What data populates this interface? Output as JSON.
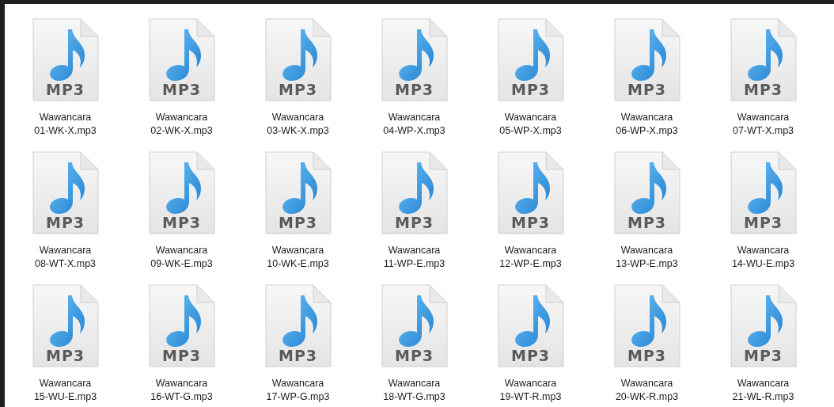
{
  "files": [
    {
      "name": "Wawancara\n01-WK-X.mp3",
      "type_label": "MP3",
      "selected": false
    },
    {
      "name": "Wawancara\n02-WK-X.mp3",
      "type_label": "MP3",
      "selected": false
    },
    {
      "name": "Wawancara\n03-WK-X.mp3",
      "type_label": "MP3",
      "selected": false
    },
    {
      "name": "Wawancara\n04-WP-X.mp3",
      "type_label": "MP3",
      "selected": false
    },
    {
      "name": "Wawancara\n05-WP-X.mp3",
      "type_label": "MP3",
      "selected": false
    },
    {
      "name": "Wawancara\n06-WP-X.mp3",
      "type_label": "MP3",
      "selected": false
    },
    {
      "name": "Wawancara\n07-WT-X.mp3",
      "type_label": "MP3",
      "selected": false
    },
    {
      "name": "Wawancara\n08-WT-X.mp3",
      "type_label": "MP3",
      "selected": false
    },
    {
      "name": "Wawancara\n09-WK-E.mp3",
      "type_label": "MP3",
      "selected": false
    },
    {
      "name": "Wawancara\n10-WK-E.mp3",
      "type_label": "MP3",
      "selected": false
    },
    {
      "name": "Wawancara\n11-WP-E.mp3",
      "type_label": "MP3",
      "selected": false
    },
    {
      "name": "Wawancara\n12-WP-E.mp3",
      "type_label": "MP3",
      "selected": false
    },
    {
      "name": "Wawancara\n13-WP-E.mp3",
      "type_label": "MP3",
      "selected": false
    },
    {
      "name": "Wawancara\n14-WU-E.mp3",
      "type_label": "MP3",
      "selected": false
    },
    {
      "name": "Wawancara\n15-WU-E.mp3",
      "type_label": "MP3",
      "selected": false
    },
    {
      "name": "Wawancara\n16-WT-G.mp3",
      "type_label": "MP3",
      "selected": false
    },
    {
      "name": "Wawancara\n17-WP-G.mp3",
      "type_label": "MP3",
      "selected": false
    },
    {
      "name": "Wawancara\n18-WT-G.mp3",
      "type_label": "MP3",
      "selected": false
    },
    {
      "name": "Wawancara\n19-WT-R.mp3",
      "type_label": "MP3",
      "selected": false
    },
    {
      "name": "Wawancara\n20-WK-R.mp3",
      "type_label": "MP3",
      "selected": false
    },
    {
      "name": "Wawancara\n21-WL-R.mp3",
      "type_label": "MP3",
      "selected": false
    }
  ]
}
